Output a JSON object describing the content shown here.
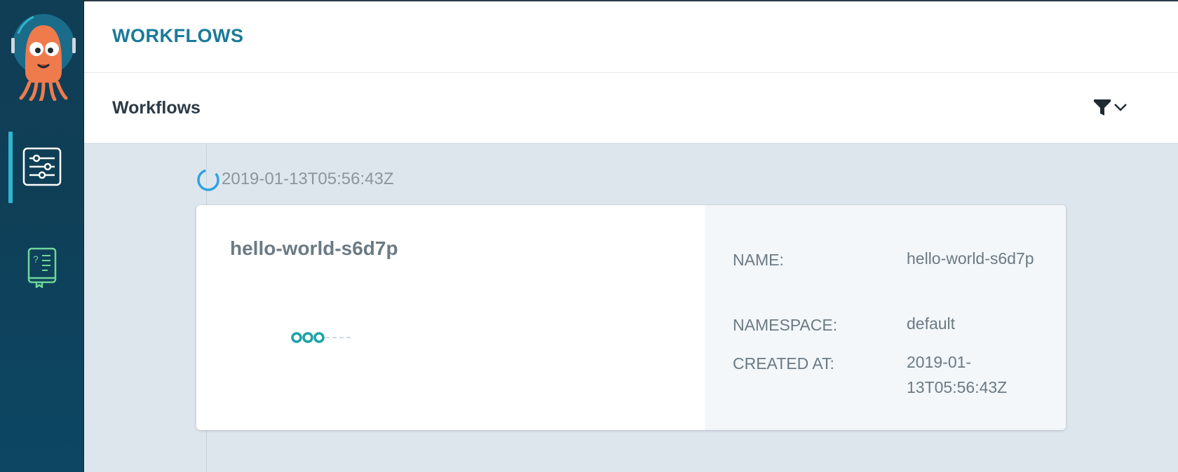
{
  "header": {
    "title": "WORKFLOWS"
  },
  "subheader": {
    "title": "Workflows"
  },
  "nav": {
    "items": [
      {
        "name": "workflows",
        "icon": "sliders-icon",
        "active": true
      },
      {
        "name": "help",
        "icon": "help-book-icon",
        "active": false
      }
    ]
  },
  "timeline": {
    "date": "2019-01-13T05:56:43Z"
  },
  "workflow": {
    "name": "hello-world-s6d7p",
    "details": {
      "name_label": "NAME:",
      "name_value": "hello-world-s6d7p",
      "namespace_label": "NAMESPACE:",
      "namespace_value": "default",
      "created_label": "CREATED AT:",
      "created_value": "2019-01-13T05:56:43Z"
    }
  },
  "colors": {
    "accent": "#1a7a99",
    "sidebar": "#103e55",
    "active_indicator": "#2fb5cf",
    "node_teal": "#1aa3a8",
    "help_icon": "#6fd69a"
  }
}
